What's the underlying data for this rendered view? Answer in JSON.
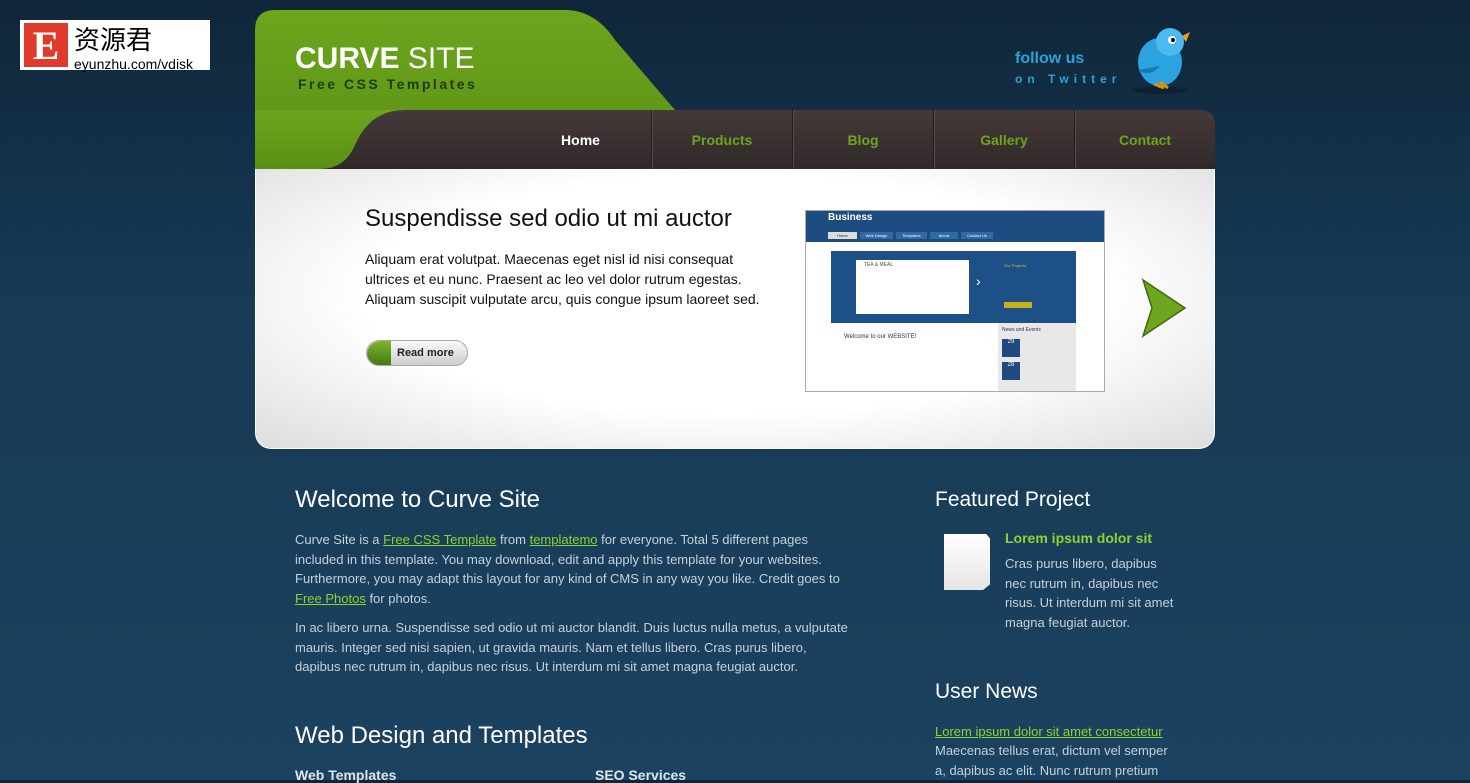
{
  "watermark": {
    "letter": "E",
    "chinese": "资源君",
    "url": "eyunzhu.com/vdisk"
  },
  "header": {
    "title_bold": "CURVE",
    "title_rest": " SITE",
    "subtitle": "Free CSS Templates",
    "follow": "follow us",
    "follow_sub": "on Twitter"
  },
  "nav": [
    {
      "label": "Home"
    },
    {
      "label": "Products"
    },
    {
      "label": "Blog"
    },
    {
      "label": "Gallery"
    },
    {
      "label": "Contact"
    }
  ],
  "slider": {
    "title": "Suspendisse sed odio ut mi auctor",
    "text": "Aliquam erat volutpat. Maecenas eget nisl id nisi consequat ultrices et eu nunc. Praesent ac leo vel dolor rutrum egestas. Aliquam suscipit vulputate arcu, quis congue ipsum laoreet sed.",
    "button": "Read more",
    "preview": {
      "brand": "Business",
      "tabs": [
        "Home",
        "Web Design",
        "Templates",
        "About",
        "Contact Us"
      ],
      "welcome": "Welcome to our WEBSITE!",
      "projects": "Our Projects",
      "news": "News and Events",
      "logo": "TEA & MEAL",
      "dates": [
        "29",
        "28"
      ]
    }
  },
  "main": {
    "welcome_title": "Welcome to Curve Site",
    "p1": {
      "t1": "Curve Site is a ",
      "l1": "Free CSS Template",
      "t2": " from ",
      "l2": "templatemo",
      "t3": " for everyone. Total 5 different pages included in this template. You may download, edit and apply this template for your websites. Furthermore, you may adapt this layout for any kind of CMS in any way you like. Credit goes to ",
      "l3": "Free Photos",
      "t4": " for photos."
    },
    "p2": "In ac libero urna. Suspendisse sed odio ut mi auctor blandit. Duis luctus nulla metus, a vulputate mauris. Integer sed nisi sapien, ut gravida mauris. Nam et tellus libero. Cras purus libero, dapibus nec rutrum in, dapibus nec risus. Ut interdum mi sit amet magna feugiat auctor.",
    "wd_title": "Web Design and Templates",
    "col1": "Web Templates",
    "col2": "SEO Services"
  },
  "sidebar": {
    "featured_title": "Featured Project",
    "featured_item_title": "Lorem ipsum dolor sit",
    "featured_item_text": "Cras purus libero, dapibus nec rutrum in, dapibus nec risus. Ut interdum mi sit amet magna feugiat auctor.",
    "news_title": "User News",
    "news_link": "Lorem ipsum dolor sit amet consectetur",
    "news_text": "Maecenas tellus erat, dictum vel semper a, dapibus ac elit. Nunc rutrum pretium"
  },
  "colors": {
    "accent_green": "#6ea51d",
    "link_green": "#8fd22e",
    "nav_bg": "#3a3030",
    "twitter_blue": "#2aa3d8"
  }
}
